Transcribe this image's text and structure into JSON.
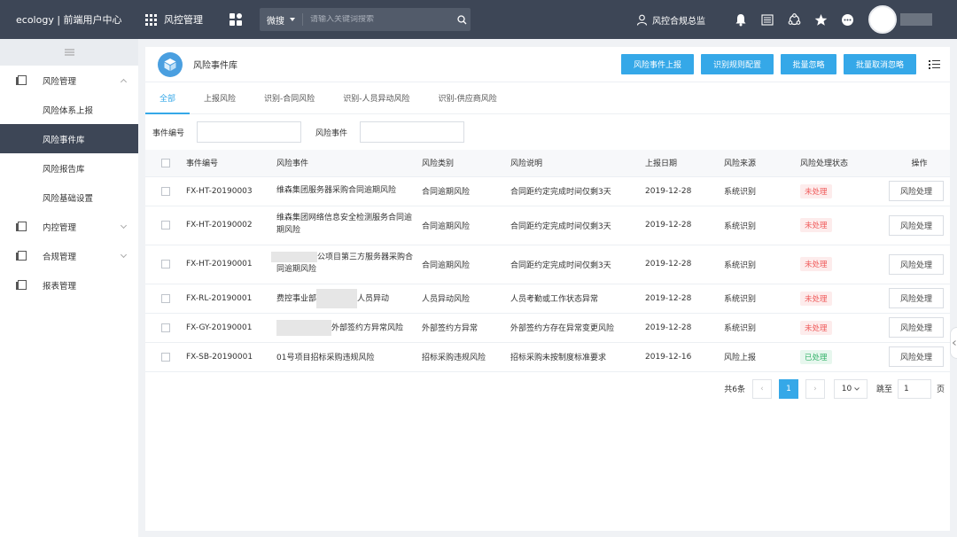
{
  "app": {
    "brand": "ecology | 前端用户中心",
    "module": "风控管理"
  },
  "search": {
    "scope": "微搜",
    "placeholder": "请输入关键词搜索"
  },
  "user": {
    "role": "风控合规总监"
  },
  "sidebar": {
    "groups": [
      {
        "label": "风险管理",
        "expanded": true,
        "items": [
          {
            "label": "风险体系上报"
          },
          {
            "label": "风险事件库",
            "active": true
          },
          {
            "label": "风险报告库"
          },
          {
            "label": "风险基础设置"
          }
        ]
      },
      {
        "label": "内控管理",
        "expanded": false
      },
      {
        "label": "合规管理",
        "expanded": false
      },
      {
        "label": "报表管理"
      }
    ]
  },
  "page": {
    "title": "风险事件库",
    "actions": [
      "风险事件上报",
      "识别规则配置",
      "批量忽略",
      "批量取消忽略"
    ]
  },
  "tabs": [
    "全部",
    "上报风险",
    "识别-合同风险",
    "识别-人员异动风险",
    "识别-供应商风险"
  ],
  "filters": {
    "event_no_label": "事件编号",
    "event_label": "风险事件"
  },
  "table": {
    "headers": [
      "事件编号",
      "风险事件",
      "风险类别",
      "风险说明",
      "上报日期",
      "风险来源",
      "风险处理状态",
      "操作"
    ],
    "op_label": "风险处理",
    "rows": [
      {
        "no": "FX-HT-20190003",
        "event": "维森集团服务器采购合同逾期风险",
        "category": "合同逾期风险",
        "desc": "合同距约定完成时间仅剩3天",
        "date": "2019-12-28",
        "source": "系统识别",
        "status": "未处理"
      },
      {
        "no": "FX-HT-20190002",
        "event": "维森集团网络信息安全检测服务合同逾期风险",
        "category": "合同逾期风险",
        "desc": "合同距约定完成时间仅剩3天",
        "date": "2019-12-28",
        "source": "系统识别",
        "status": "未处理"
      },
      {
        "no": "FX-HT-20190001",
        "event": "公项目第三方服务器采购合同逾期风险",
        "category": "合同逾期风险",
        "desc": "合同距约定完成时间仅剩3天",
        "date": "2019-12-28",
        "source": "系统识别",
        "status": "未处理"
      },
      {
        "no": "FX-RL-20190001",
        "event_a": "费控事业部",
        "event_b": "人员异动",
        "category": "人员异动风险",
        "desc": "人员考勤或工作状态异常",
        "date": "2019-12-28",
        "source": "系统识别",
        "status": "未处理"
      },
      {
        "no": "FX-GY-20190001",
        "event": "外部签约方异常风险",
        "category": "外部签约方异常",
        "desc": "外部签约方存在异常变更风险",
        "date": "2019-12-28",
        "source": "系统识别",
        "status": "未处理"
      },
      {
        "no": "FX-SB-20190001",
        "event": "01号项目招标采购违规风险",
        "category": "招标采购违规风险",
        "desc": "招标采购未按制度标准要求",
        "date": "2019-12-16",
        "source": "风险上报",
        "status": "已处理"
      }
    ]
  },
  "pager": {
    "total": "共6条",
    "current": "1",
    "size": "10",
    "goto": "跳至",
    "goto_value": "1",
    "unit": "页"
  },
  "colors": {
    "accent": "#35a8e8",
    "topbar": "#3d4656",
    "pending": "#f05a5a",
    "done": "#36b36b"
  }
}
